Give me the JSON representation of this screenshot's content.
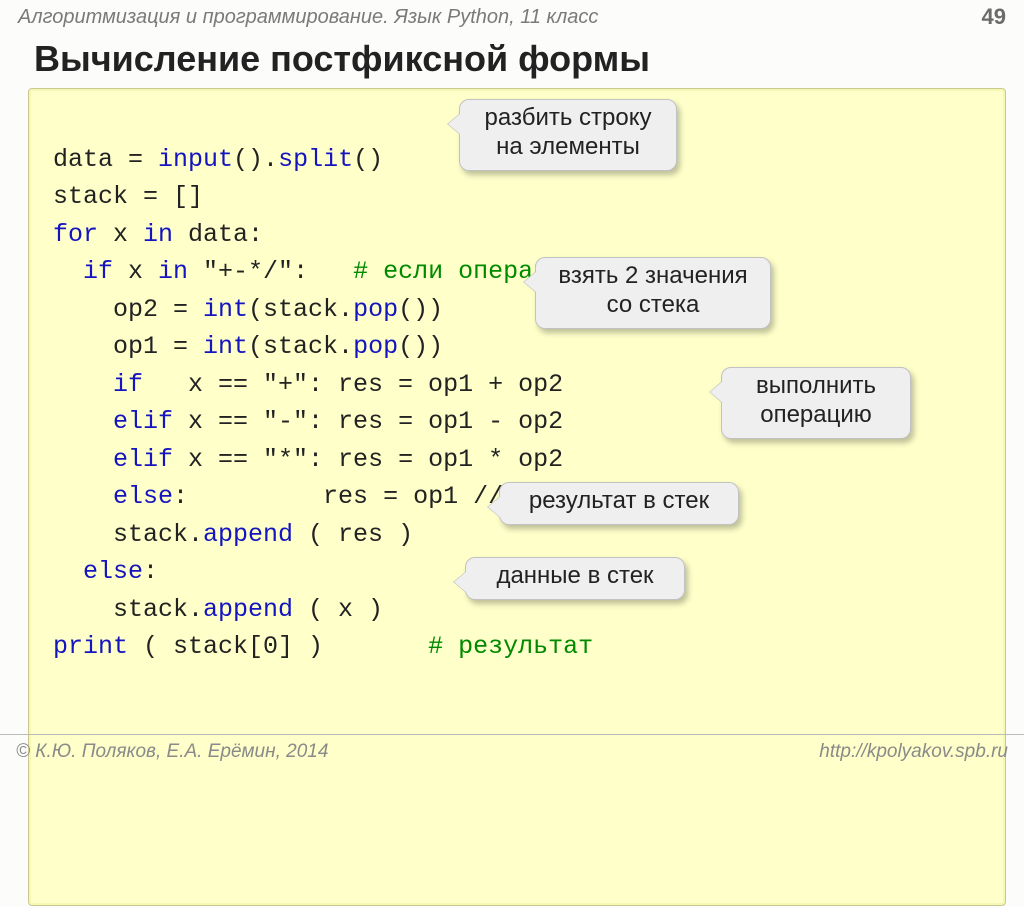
{
  "header": {
    "subject": "Алгоритмизация и программирование. Язык Python, 11 класс",
    "page_number": "49"
  },
  "title": "Вычисление постфиксной формы",
  "callouts": {
    "split": "разбить строку\nна элементы",
    "pop2": "взять 2 значения\nсо стека",
    "execute": "выполнить\nоперацию",
    "push_res": "результат в стек",
    "push_data": "данные в стек"
  },
  "code": {
    "l1a": "data = ",
    "l1b": "input",
    "l1c": "().",
    "l1d": "split",
    "l1e": "()",
    "l2": "stack = []",
    "l3a": "for",
    "l3b": " x ",
    "l3c": "in",
    "l3d": " data:",
    "l4a": "  if",
    "l4b": " x ",
    "l4c": "in",
    "l4d": " \"+-*/\":   ",
    "l4e": "# если операция",
    "l5a": "    op2 = ",
    "l5b": "int",
    "l5c": "(stack.",
    "l5d": "pop",
    "l5e": "())",
    "l6a": "    op1 = ",
    "l6b": "int",
    "l6c": "(stack.",
    "l6d": "pop",
    "l6e": "())",
    "l7a": "    if",
    "l7b": "   x == \"+\": res = op1 + op2",
    "l8a": "    elif",
    "l8b": " x == \"-\": res = op1 - op2",
    "l9a": "    elif",
    "l9b": " x == \"*\": res = op1 * op2",
    "l10a": "    else",
    "l10b": ":         res = op1 // op2",
    "l11a": "    stack.",
    "l11b": "append",
    "l11c": " ( res )",
    "l12a": "  else",
    "l12b": ":",
    "l13a": "    stack.",
    "l13b": "append",
    "l13c": " ( x )",
    "l14a": "print",
    "l14b": " ( stack[0] )       ",
    "l14c": "# результат"
  },
  "footer": {
    "copyright": "© К.Ю. Поляков, Е.А. Ерёмин, 2014",
    "url": "http://kpolyakov.spb.ru"
  }
}
